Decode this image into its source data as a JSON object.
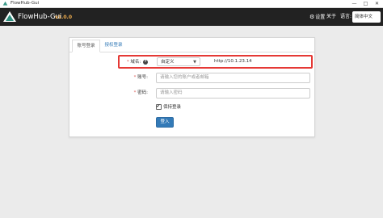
{
  "window": {
    "title": "FlowHub-Gui",
    "minimize": "—",
    "maximize": "□",
    "close": "✕"
  },
  "navbar": {
    "app_name": "FlowHub-Gui",
    "version": "v1.0.0",
    "settings_label": "设置",
    "about_label": "关于",
    "language_label": "语言:",
    "language_value": "简体中文"
  },
  "tabs": [
    {
      "label": "账号登录",
      "active": true
    },
    {
      "label": "授权登录",
      "active": false
    }
  ],
  "form": {
    "domain": {
      "required_mark": "*",
      "label": "域名:",
      "help_icon": "?",
      "mode_value": "自定义",
      "url_value": "http://10.1.23.14"
    },
    "account": {
      "required_mark": "*",
      "label": "账号:",
      "placeholder": "请输入您的账户或者邮箱"
    },
    "password": {
      "required_mark": "*",
      "label": "密码:",
      "placeholder": "请输入密码"
    },
    "keep_login": {
      "label": "保持登录",
      "checked": true
    },
    "login_button": "登入"
  },
  "colors": {
    "navbar_bg": "#222222",
    "version": "#f0ad4e",
    "primary": "#337ab7",
    "highlight": "#e53935",
    "required": "#d9534f"
  }
}
